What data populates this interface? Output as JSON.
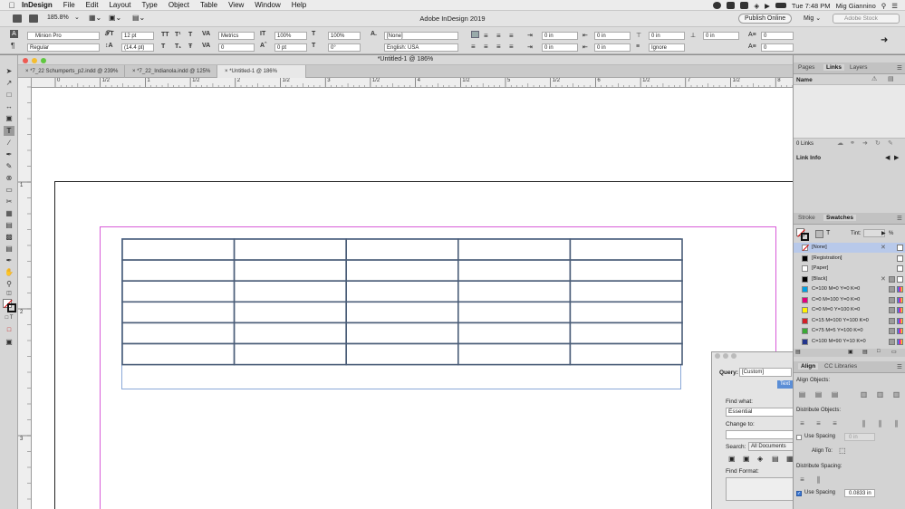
{
  "menubar": {
    "app_name": "InDesign",
    "items": [
      "File",
      "Edit",
      "Layout",
      "Type",
      "Object",
      "Table",
      "View",
      "Window",
      "Help"
    ],
    "clock": "Tue 7:48 PM",
    "user": "Mig Giannino"
  },
  "appbar": {
    "zoom": "185.8%",
    "title": "Adobe InDesign 2019",
    "publish_label": "Publish Online",
    "workspace": "Mig",
    "stock_placeholder": "Adobe Stock"
  },
  "control": {
    "font_family": "Minion Pro",
    "font_style": "Regular",
    "font_size": "12 pt",
    "leading": "(14.4 pt)",
    "kerning": "Metrics",
    "tracking": "0",
    "vscale": "100%",
    "hscale": "100%",
    "baseline": "0 pt",
    "skew": "0°",
    "char_style": "[None]",
    "language": "English: USA",
    "indent_left": "0 in",
    "indent_first": "0 in",
    "indent_right": "0 in",
    "indent_last": "0 in",
    "space_before": "0 in",
    "space_after": "0 in",
    "drop_lines": "0",
    "drop_chars": "0",
    "hyphenate": "Ignore",
    "tt_a": "TT",
    "tt_b": "T¹",
    "tt_c": "T",
    "tt_d": "T",
    "tt_e": "T₁",
    "tt_f": "Ŧ"
  },
  "document": {
    "window_title": "*Untitled-1 @ 186%",
    "tabs": [
      "*7_22 Schumperts_p2.indd @ 239%",
      "*7_22_Indianola.indd @ 125%",
      "*Untitled-1 @ 186%"
    ],
    "active_tab": 2
  },
  "rulers": {
    "h_labels": [
      "0",
      "1/2",
      "1",
      "1/2",
      "2",
      "1/2",
      "3",
      "1/2",
      "4",
      "1/2",
      "5",
      "1/2",
      "6",
      "1/2",
      "7",
      "1/2",
      "8"
    ],
    "v_labels": [
      "1",
      "2",
      "3"
    ]
  },
  "table": {
    "columns": 5,
    "rows": 6
  },
  "links_panel": {
    "tabs": [
      "Pages",
      "Links",
      "Layers"
    ],
    "active": "Links",
    "name_header": "Name",
    "count": "0 Links",
    "info": "Link Info"
  },
  "swatches_panel": {
    "tabs": [
      "Stroke",
      "Swatches"
    ],
    "active": "Swatches",
    "tint_label": "Tint:",
    "tint_unit": "%",
    "items": [
      {
        "name": "[None]",
        "color": "#ffffff",
        "selected": true
      },
      {
        "name": "[Registration]",
        "color": "#000000"
      },
      {
        "name": "[Paper]",
        "color": "#ffffff"
      },
      {
        "name": "[Black]",
        "color": "#000000"
      },
      {
        "name": "C=100 M=0 Y=0 K=0",
        "color": "#00a0e3"
      },
      {
        "name": "C=0 M=100 Y=0 K=0",
        "color": "#e4007d"
      },
      {
        "name": "C=0 M=0 Y=100 K=0",
        "color": "#fff200"
      },
      {
        "name": "C=15 M=100 Y=100 K=0",
        "color": "#d21f26"
      },
      {
        "name": "C=75 M=5 Y=100 K=0",
        "color": "#3aa935"
      },
      {
        "name": "C=100 M=90 Y=10 K=0",
        "color": "#23358d"
      }
    ]
  },
  "align_panel": {
    "tabs": [
      "Align",
      "CC Libraries"
    ],
    "align_objects": "Align Objects:",
    "distribute_objects": "Distribute Objects:",
    "use_spacing_1": "Use Spacing",
    "spacing_value_1": "0 in",
    "align_to": "Align To:",
    "distribute_spacing": "Distribute Spacing:",
    "use_spacing_2": "Use Spacing",
    "spacing_value_2": "0.0833 in"
  },
  "find_panel": {
    "query_label": "Query:",
    "query_value": "[Custom]",
    "text_tab": "Text",
    "find_what_label": "Find what:",
    "find_what_value": "Essential",
    "change_to_label": "Change to:",
    "change_to_value": "",
    "search_label": "Search:",
    "search_value": "All Documents",
    "find_format_label": "Find Format:"
  },
  "colors": {
    "frame_guide": "#d85cd8",
    "table_stroke": "#4a5d78",
    "text_frame": "#8aa8d8"
  }
}
